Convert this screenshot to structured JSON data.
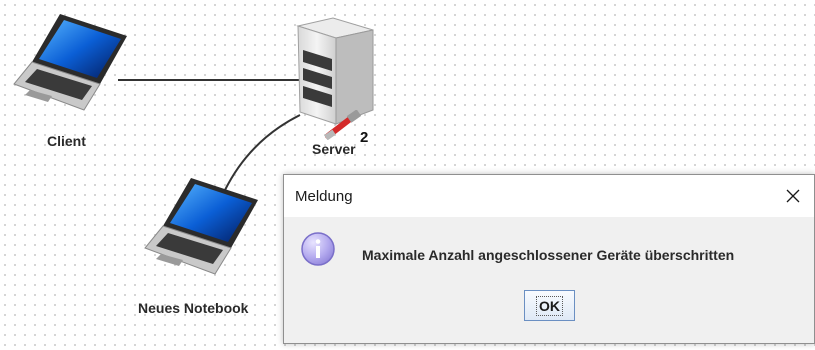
{
  "network": {
    "nodes": [
      {
        "id": "client",
        "label": "Client",
        "type": "laptop"
      },
      {
        "id": "server",
        "label": "Server",
        "type": "server",
        "port_count": "2"
      },
      {
        "id": "neues-notebook",
        "label": "Neues Notebook",
        "type": "laptop"
      }
    ]
  },
  "icons": {
    "laptop": "laptop-icon",
    "server": "server-icon",
    "network_cable": "network-cable-icon",
    "info": "info-icon",
    "close": "close-icon"
  },
  "dialog": {
    "title": "Meldung",
    "message": "Maximale Anzahl angeschlossener Geräte überschritten",
    "ok_label": "OK",
    "close_glyph": "✕"
  },
  "colors": {
    "dialog_background": "#f0f0f0",
    "titlebar_background": "#ffffff",
    "info_icon": "#9a8fdc",
    "cable": "#d42a2a",
    "link": "#333333"
  }
}
